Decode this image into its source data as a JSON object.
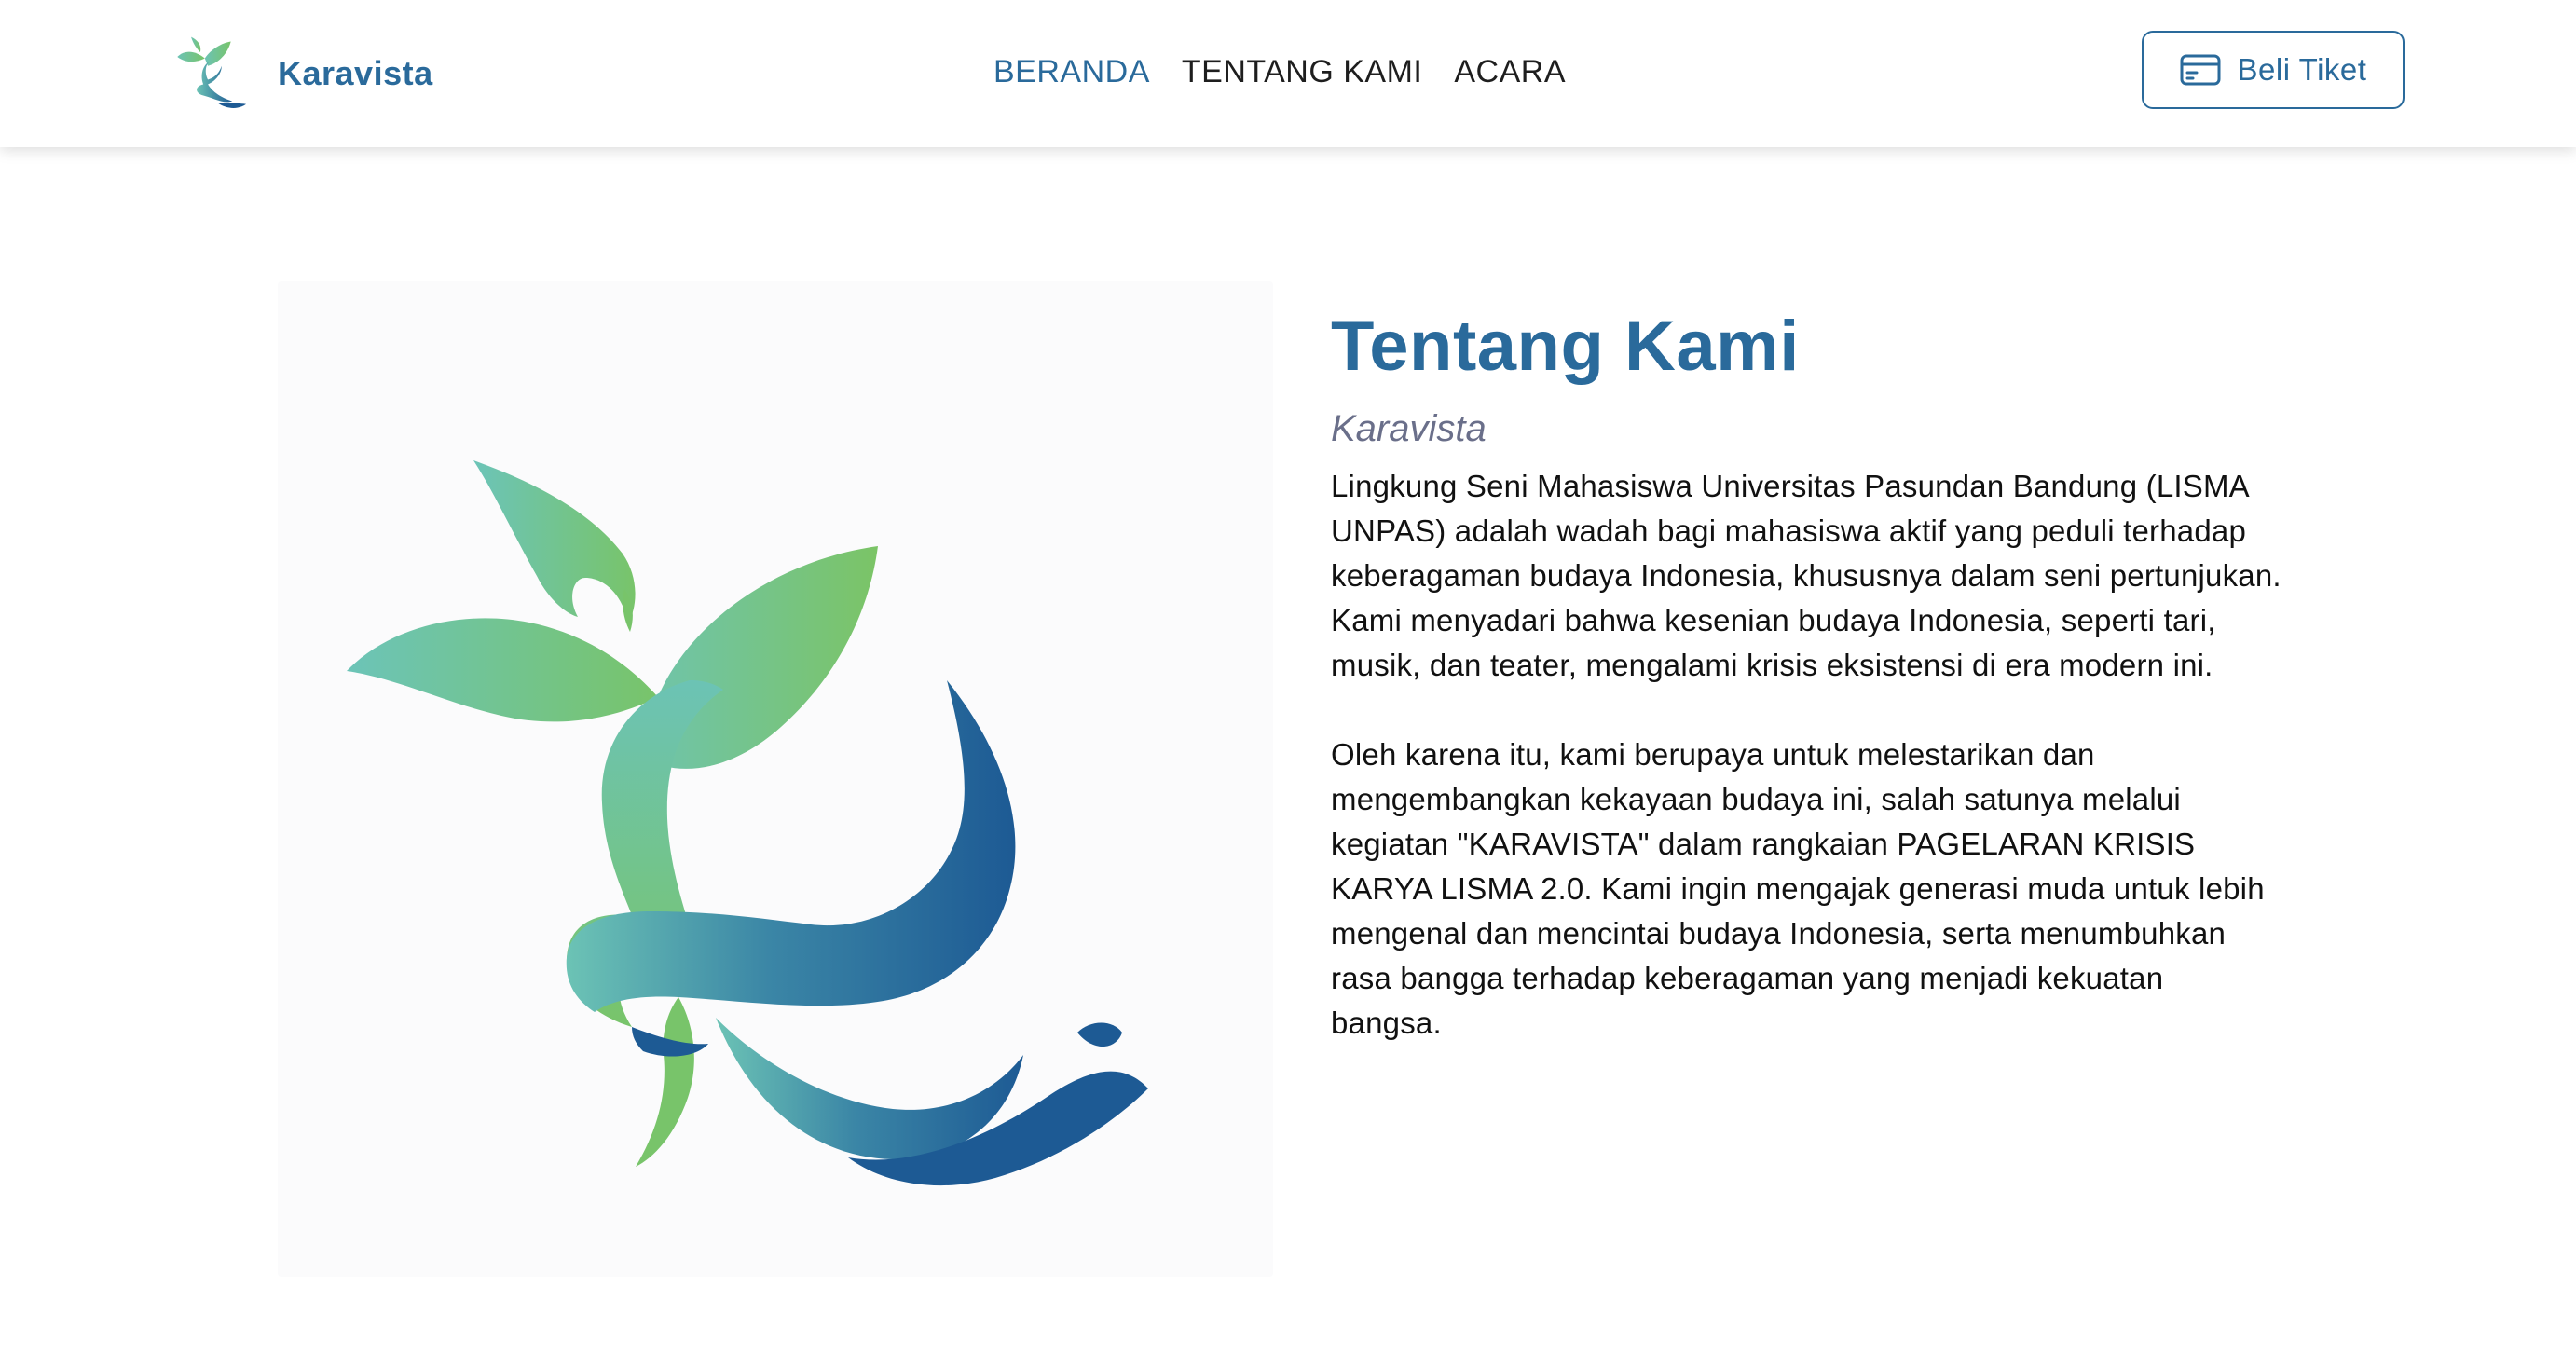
{
  "header": {
    "brand_name": "Karavista",
    "logo_icon": "karavista-logo-icon",
    "nav": [
      {
        "label": "BERANDA",
        "active": true
      },
      {
        "label": "TENTANG KAMI",
        "active": false
      },
      {
        "label": "ACARA",
        "active": false
      }
    ],
    "ticket_button": {
      "label": "Beli Tiket",
      "icon": "credit-card-icon"
    }
  },
  "about": {
    "title": "Tentang Kami",
    "subtitle": "Karavista",
    "paragraphs": [
      "Lingkung Seni Mahasiswa Universitas Pasundan Bandung (LISMA UNPAS) adalah wadah bagi mahasiswa aktif yang peduli terhadap keberagaman budaya Indonesia, khususnya dalam seni pertunjukan. Kami menyadari bahwa kesenian budaya Indonesia, seperti tari, musik, dan teater, mengalami krisis eksistensi di era modern ini.",
      "Oleh karena itu, kami berupaya untuk melestarikan dan mengembangkan kekayaan budaya ini, salah satunya melalui kegiatan \"KARAVISTA\" dalam rangkaian PAGELARAN KRISIS KARYA LISMA 2.0. Kami ingin mengajak generasi muda untuk lebih mengenal dan mencintai budaya Indonesia, serta menumbuhkan rasa bangga terhadap keberagaman yang menjadi kekuatan bangsa."
    ],
    "image_icon": "karavista-emblem-image"
  },
  "colors": {
    "primary": "#2a6a9b",
    "green": "#78c46a",
    "teal": "#6cc3b5",
    "navy": "#1d5a94",
    "subtitle": "#6a6f8a"
  }
}
